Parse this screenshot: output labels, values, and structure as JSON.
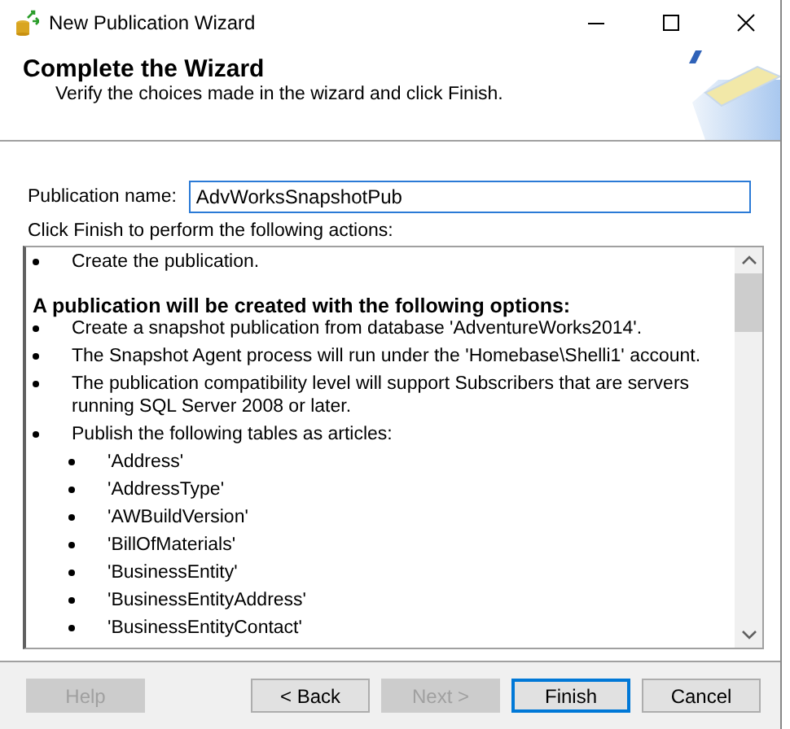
{
  "window": {
    "title": "New Publication Wizard"
  },
  "header": {
    "title": "Complete the Wizard",
    "subtitle": "Verify the choices made in the wizard and click Finish."
  },
  "publication_name": {
    "label": "Publication name:",
    "value": "AdvWorksSnapshotPub"
  },
  "actions_label": "Click Finish to perform the following actions:",
  "actions": [
    {
      "kind": "bullet",
      "text": "Create the publication."
    },
    {
      "kind": "heading",
      "text": "A publication will be created with the following options:"
    },
    {
      "kind": "bullet",
      "text": "Create a snapshot publication from database 'AdventureWorks2014'."
    },
    {
      "kind": "bullet",
      "text": "The Snapshot Agent process will run under the 'Homebase\\Shelli1' account."
    },
    {
      "kind": "bullet",
      "text": "The publication compatibility level will support Subscribers that are servers running SQL Server 2008 or later."
    },
    {
      "kind": "bullet",
      "text": "Publish the following tables as articles:",
      "children": [
        {
          "text": "'Address'"
        },
        {
          "text": "'AddressType'"
        },
        {
          "text": "'AWBuildVersion'"
        },
        {
          "text": "'BillOfMaterials'"
        },
        {
          "text": "'BusinessEntity'"
        },
        {
          "text": "'BusinessEntityAddress'"
        },
        {
          "text": "'BusinessEntityContact'"
        }
      ]
    }
  ],
  "buttons": [
    {
      "label": "Help",
      "disabled": true,
      "default": false
    },
    {
      "label": "< Back",
      "disabled": false,
      "default": false
    },
    {
      "label": "Next >",
      "disabled": true,
      "default": false
    },
    {
      "label": "Finish",
      "disabled": false,
      "default": true
    },
    {
      "label": "Cancel",
      "disabled": false,
      "default": false
    }
  ]
}
